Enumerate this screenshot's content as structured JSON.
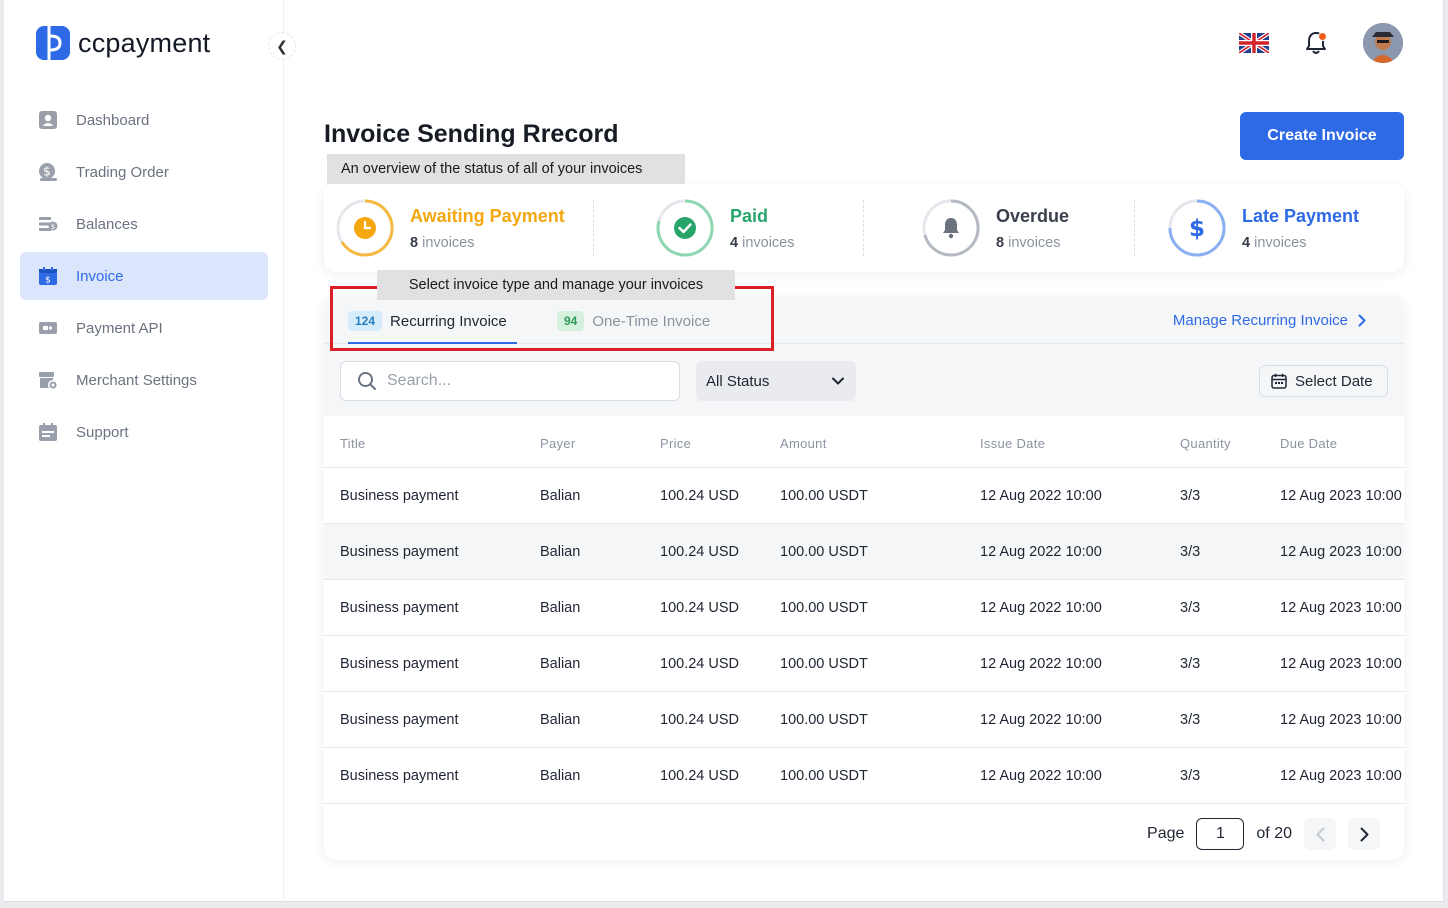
{
  "brand": {
    "name": "ccpayment",
    "color": "#2f6ae6"
  },
  "sidebar": {
    "items": [
      {
        "label": "Dashboard",
        "icon": "dashboard-icon"
      },
      {
        "label": "Trading Order",
        "icon": "trading-order-icon"
      },
      {
        "label": "Balances",
        "icon": "balances-icon"
      },
      {
        "label": "Invoice",
        "icon": "invoice-icon",
        "active": true
      },
      {
        "label": "Payment API",
        "icon": "payment-api-icon"
      },
      {
        "label": "Merchant Settings",
        "icon": "merchant-settings-icon"
      },
      {
        "label": "Support",
        "icon": "support-icon"
      }
    ]
  },
  "topbar": {
    "language_icon": "uk-flag-icon",
    "notification_icon": "bell-icon",
    "avatar": "user-avatar"
  },
  "page": {
    "title": "Invoice Sending Rrecord",
    "create_label": "Create Invoice",
    "tooltip_overview": "An overview of the status of all of your invoices",
    "tooltip_tabs": "Select invoice type and manage your invoices"
  },
  "stats": [
    {
      "title": "Awaiting Payment",
      "count": "8",
      "unit": "invoices",
      "color": "#f5a70f",
      "icon": "clock-icon"
    },
    {
      "title": "Paid",
      "count": "4",
      "unit": "invoices",
      "color": "#27a56b",
      "icon": "check-icon"
    },
    {
      "title": "Overdue",
      "count": "8",
      "unit": "invoices",
      "color": "#6b7380",
      "icon": "bell-icon"
    },
    {
      "title": "Late Payment",
      "count": "4",
      "unit": "invoices",
      "color": "#2f6ae6",
      "icon": "dollar-icon"
    }
  ],
  "tabs": [
    {
      "count": "124",
      "label": "Recurring Invoice",
      "active": true
    },
    {
      "count": "94",
      "label": "One-Time Invoice"
    }
  ],
  "manage_link": "Manage Recurring Invoice",
  "filters": {
    "search_placeholder": "Search...",
    "status": "All Status",
    "date_label": "Select Date"
  },
  "table": {
    "columns": [
      "Title",
      "Payer",
      "Price",
      "Amount",
      "Issue Date",
      "Quantity",
      "Due Date"
    ],
    "rows": [
      [
        "Business payment",
        "Balian",
        "100.24 USD",
        "100.00 USDT",
        "12 Aug 2022 10:00",
        "3/3",
        "12 Aug 2023 10:00"
      ],
      [
        "Business payment",
        "Balian",
        "100.24 USD",
        "100.00 USDT",
        "12 Aug 2022 10:00",
        "3/3",
        "12 Aug 2023 10:00"
      ],
      [
        "Business payment",
        "Balian",
        "100.24 USD",
        "100.00 USDT",
        "12 Aug 2022 10:00",
        "3/3",
        "12 Aug 2023 10:00"
      ],
      [
        "Business payment",
        "Balian",
        "100.24 USD",
        "100.00 USDT",
        "12 Aug 2022 10:00",
        "3/3",
        "12 Aug 2023 10:00"
      ],
      [
        "Business payment",
        "Balian",
        "100.24 USD",
        "100.00 USDT",
        "12 Aug 2022 10:00",
        "3/3",
        "12 Aug 2023 10:00"
      ],
      [
        "Business payment",
        "Balian",
        "100.24 USD",
        "100.00 USDT",
        "12 Aug 2022 10:00",
        "3/3",
        "12 Aug 2023 10:00"
      ]
    ]
  },
  "pagination": {
    "label": "Page",
    "current": "1",
    "total_label": "of 20"
  }
}
